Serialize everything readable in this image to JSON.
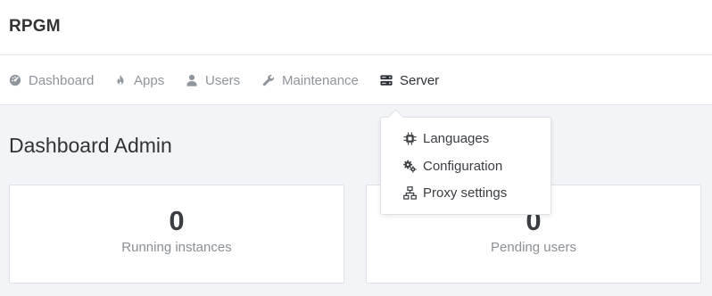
{
  "app": {
    "brand": "RPGM"
  },
  "nav": {
    "items": [
      {
        "label": "Dashboard",
        "icon": "dashboard-icon"
      },
      {
        "label": "Apps",
        "icon": "fire-icon"
      },
      {
        "label": "Users",
        "icon": "user-icon"
      },
      {
        "label": "Maintenance",
        "icon": "wrench-icon"
      },
      {
        "label": "Server",
        "icon": "server-icon",
        "active": true
      }
    ]
  },
  "page": {
    "title": "Dashboard Admin"
  },
  "cards": [
    {
      "value": "0",
      "label": "Running instances"
    },
    {
      "value": "0",
      "label": "Pending users"
    }
  ],
  "dropdown": {
    "items": [
      {
        "label": "Languages",
        "icon": "chip-icon"
      },
      {
        "label": "Configuration",
        "icon": "gears-icon"
      },
      {
        "label": "Proxy settings",
        "icon": "network-icon"
      }
    ]
  },
  "colors": {
    "muted": "#8f959c",
    "active": "#2f3338",
    "background": "#f2f4f7"
  }
}
